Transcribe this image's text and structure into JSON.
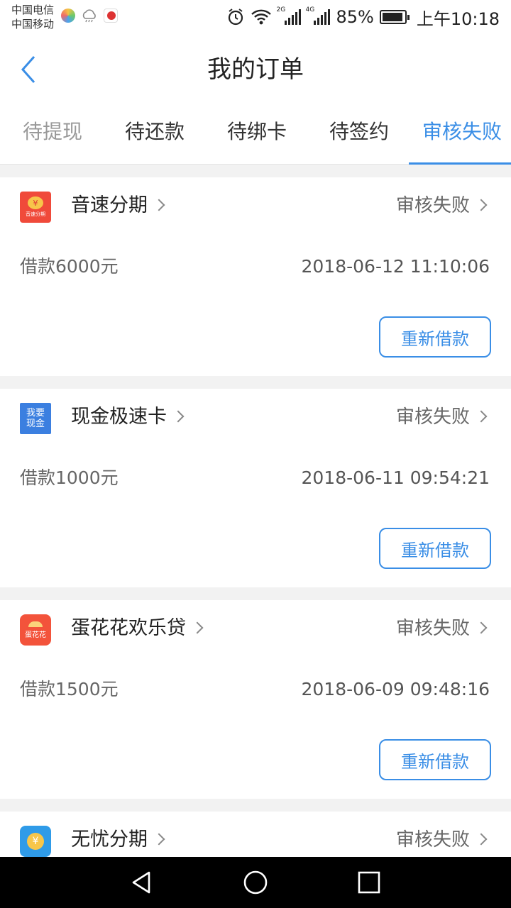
{
  "status_bar": {
    "carrier_1": "中国电信",
    "carrier_2": "中国移动",
    "battery": "85%",
    "time": "上午10:18",
    "net_1": "2G",
    "net_2": "4G",
    "icons": [
      "colorful-app-icon",
      "cloud-icon",
      "app-notification-icon",
      "alarm-icon",
      "wifi-icon",
      "signal-2g-icon",
      "signal-4g-icon",
      "battery-icon"
    ]
  },
  "header": {
    "title": "我的订单",
    "back_icon": "chevron-left-icon"
  },
  "tabs": [
    {
      "label": "待提现"
    },
    {
      "label": "待还款"
    },
    {
      "label": "待绑卡"
    },
    {
      "label": "待签约"
    },
    {
      "label": "审核失败",
      "active": true
    }
  ],
  "orders": [
    {
      "name": "音速分期",
      "status": "审核失败",
      "amount": "借款6000元",
      "time": "2018-06-12 11:10:06",
      "button": "重新借款",
      "icon_text": "¥",
      "icon_sub": "音速分期",
      "icon_color": "#f04a3a"
    },
    {
      "name": "现金极速卡",
      "status": "审核失败",
      "amount": "借款1000元",
      "time": "2018-06-11 09:54:21",
      "button": "重新借款",
      "icon_text": "我要",
      "icon_sub": "现金",
      "icon_color": "#3b7fe0"
    },
    {
      "name": "蛋花花欢乐贷",
      "status": "审核失败",
      "amount": "借款1500元",
      "time": "2018-06-09 09:48:16",
      "button": "重新借款",
      "icon_text": "",
      "icon_sub": "蛋花花",
      "icon_color": "#f3533b"
    },
    {
      "name": "无忧分期",
      "status": "审核失败",
      "icon_text": "¥",
      "icon_color": "#2f9be8"
    }
  ],
  "colors": {
    "accent": "#3a8ee6",
    "background": "#f2f2f2"
  },
  "navbar": {
    "icons": [
      "back-triangle-icon",
      "home-circle-icon",
      "recents-square-icon"
    ]
  }
}
